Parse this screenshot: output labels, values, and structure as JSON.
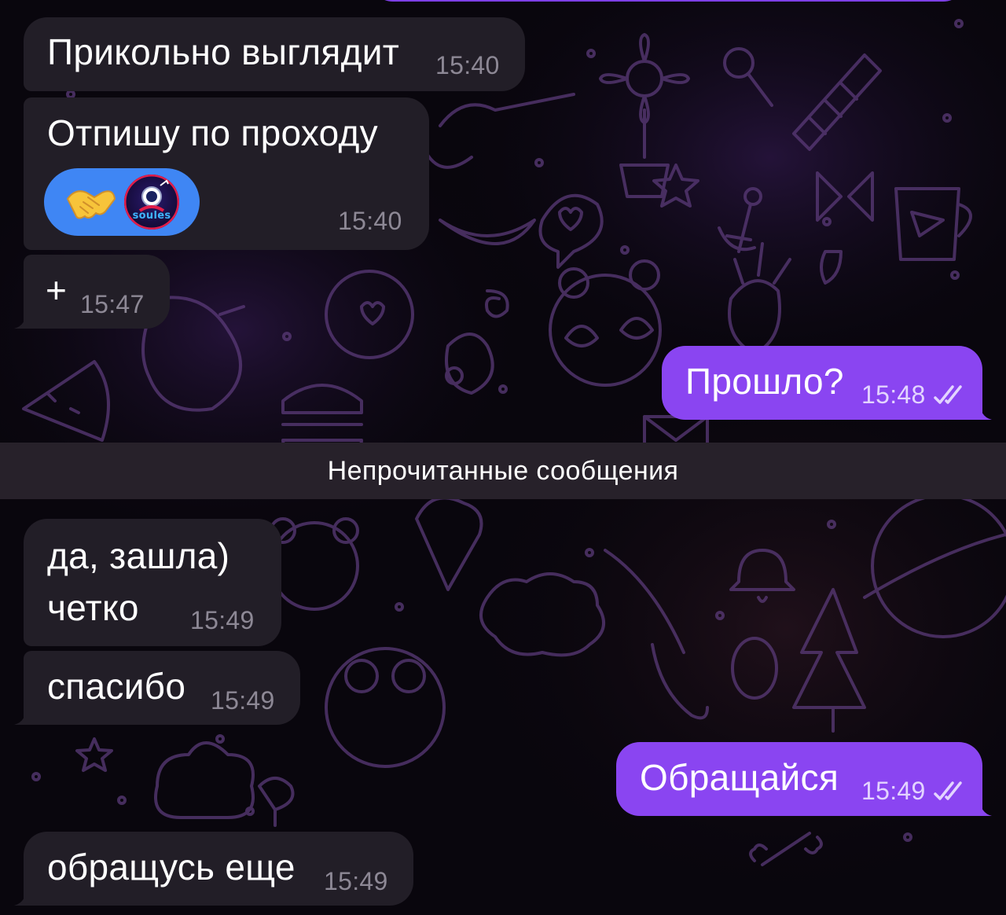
{
  "chat": {
    "messages": [
      {
        "id": "m1",
        "direction": "incoming",
        "text": "Прикольно выглядит",
        "time": "15:40"
      },
      {
        "id": "m2",
        "direction": "incoming",
        "text": "Отпишу по проходу",
        "time": "15:40",
        "reaction": {
          "emoji_icon": "handshake-icon",
          "avatar": "reactor-avatar",
          "avatar_text": "soules"
        }
      },
      {
        "id": "m3",
        "direction": "incoming",
        "text": "+",
        "time": "15:47"
      },
      {
        "id": "m4",
        "direction": "outgoing",
        "text": "Прошло?",
        "time": "15:48",
        "status_icon": "double-check-icon"
      },
      {
        "id": "m5",
        "direction": "incoming",
        "lines": [
          "да,  зашла)",
          "четко"
        ],
        "time": "15:49"
      },
      {
        "id": "m6",
        "direction": "incoming",
        "text": "спасибо",
        "time": "15:49"
      },
      {
        "id": "m7",
        "direction": "outgoing",
        "text": "Обращайся",
        "time": "15:49",
        "status_icon": "double-check-icon"
      },
      {
        "id": "m8",
        "direction": "incoming",
        "text": "обращусь еще",
        "time": "15:49"
      }
    ],
    "unread_divider": "Непрочитанные сообщения"
  },
  "colors": {
    "background": "#09060d",
    "incoming_bubble": "#221e27",
    "outgoing_bubble": "#8a45f1",
    "reaction_pill": "#3f86f4",
    "wallpaper_doodle": "#5a3a78"
  }
}
